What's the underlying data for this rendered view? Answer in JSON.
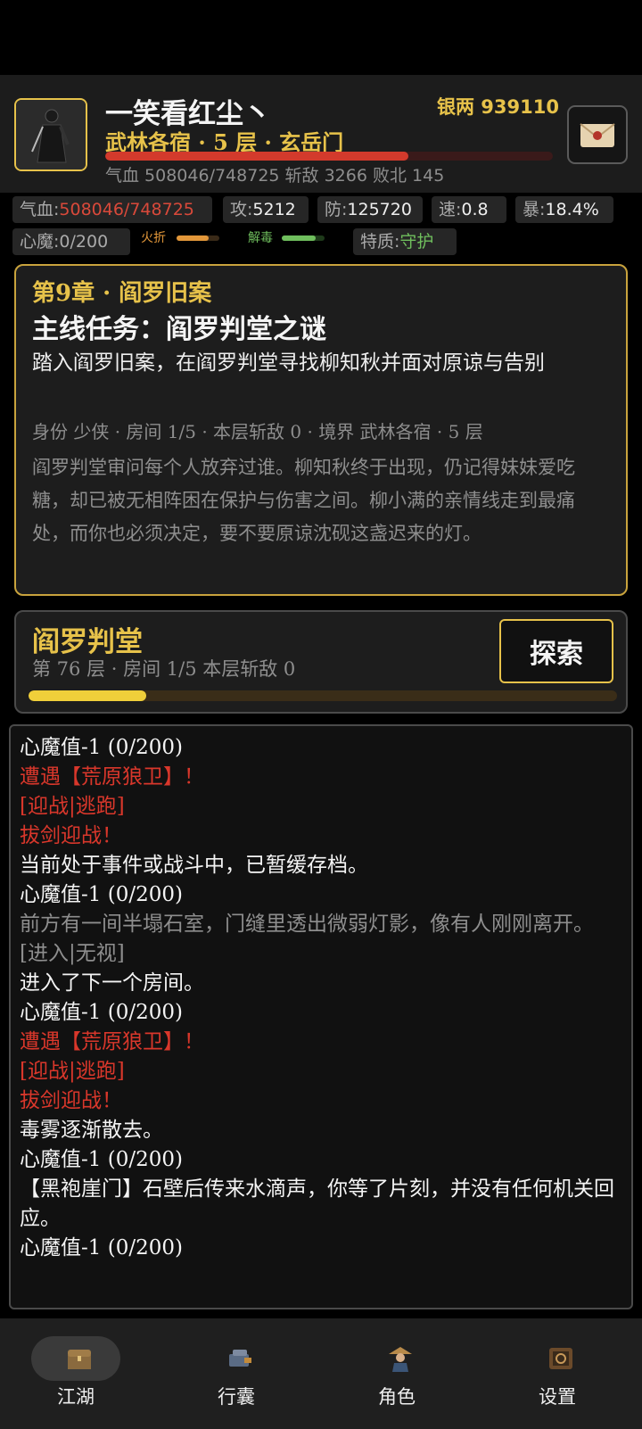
{
  "player": {
    "name": "一笑看红尘丶",
    "rank_line": "武林各宿 · 5 层 · 玄岳门",
    "hp_line": "气血 508046/748725  斩敌 3266  败北 145",
    "hp_fraction": 0.678
  },
  "currency": {
    "label": "银两 939110"
  },
  "stats": {
    "hp_label": "气血:",
    "hp_value": "508046/748725",
    "atk_label": "攻:",
    "atk_value": "5212",
    "def_label": "防:",
    "def_value": "125720",
    "spd_label": "速:",
    "spd_value": "0.8",
    "crit_label": "暴:",
    "crit_value": "18.4%",
    "demon_label": "心魔:",
    "demon_value": "0/200",
    "trait_label": "特质:",
    "trait_value": "守护"
  },
  "buffs": [
    {
      "label": "火折",
      "color": "#e2973a",
      "fraction": 0.75
    },
    {
      "label": "解毒",
      "color": "#6fbe5d",
      "fraction": 0.8
    }
  ],
  "quest": {
    "chapter": "第9章 · 阎罗旧案",
    "title": "主线任务：阎罗判堂之谜",
    "description": "踏入阎罗旧案，在阎罗判堂寻找柳知秋并面对原谅与告别",
    "info": "身份 少侠 · 房间 1/5 · 本层斩敌 0 · 境界 武林各宿 · 5 层",
    "story": "阎罗判堂审问每个人放弃过谁。柳知秋终于出现，仍记得妹妹爱吃糖，却已被无相阵困在保护与伤害之间。柳小满的亲情线走到最痛处，而你也必须决定，要不要原谅沈砚这盏迟来的灯。"
  },
  "dungeon": {
    "name": "阎罗判堂",
    "info": "第 76 层 · 房间 1/5  本层斩敌 0",
    "explore_label": "探索",
    "progress": 0.2
  },
  "log": [
    {
      "text": "心魔值-1 (0/200)",
      "style": "normal"
    },
    {
      "text": "遭遇【荒原狼卫】！",
      "style": "alert"
    },
    {
      "text": "[迎战|逃跑]",
      "style": "alert"
    },
    {
      "text": "拔剑迎战！",
      "style": "alert"
    },
    {
      "text": "当前处于事件或战斗中，已暂缓存档。",
      "style": "normal"
    },
    {
      "text": "心魔值-1 (0/200)",
      "style": "normal"
    },
    {
      "text": "前方有一间半塌石室，门缝里透出微弱灯影，像有人刚刚离开。",
      "style": "muted"
    },
    {
      "text": "[进入|无视]",
      "style": "muted"
    },
    {
      "text": "进入了下一个房间。",
      "style": "normal"
    },
    {
      "text": "心魔值-1 (0/200)",
      "style": "normal"
    },
    {
      "text": "遭遇【荒原狼卫】！",
      "style": "alert"
    },
    {
      "text": "[迎战|逃跑]",
      "style": "alert"
    },
    {
      "text": "拔剑迎战！",
      "style": "alert"
    },
    {
      "text": "毒雾逐渐散去。",
      "style": "normal"
    },
    {
      "text": "心魔值-1 (0/200)",
      "style": "normal"
    },
    {
      "text": "【黑袍崖门】石壁后传来水滴声，你等了片刻，并没有任何机关回应。",
      "style": "normal"
    },
    {
      "text": "心魔值-1 (0/200)",
      "style": "normal"
    }
  ],
  "nav": [
    {
      "label": "江湖",
      "icon": "chest-icon",
      "active": true
    },
    {
      "label": "行囊",
      "icon": "bag-icon",
      "active": false
    },
    {
      "label": "角色",
      "icon": "character-icon",
      "active": false
    },
    {
      "label": "设置",
      "icon": "settings-scroll-icon",
      "active": false
    }
  ]
}
